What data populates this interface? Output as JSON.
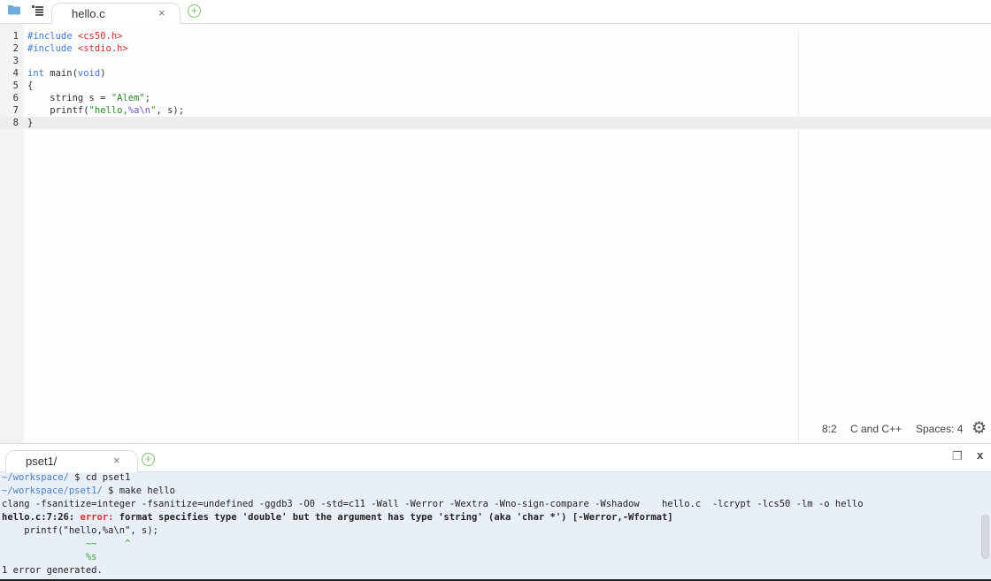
{
  "editor_tabs": [
    {
      "label": "hello.c",
      "close": "×"
    }
  ],
  "terminal_tabs": [
    {
      "label": "pset1/",
      "close": "×"
    }
  ],
  "icons": {
    "folder": "folder-icon",
    "outline": "outline-icon",
    "add": "+",
    "gear": "⚙",
    "restore": "❐",
    "close": "x"
  },
  "code_lines": [
    [
      {
        "t": "#include ",
        "c": "kw"
      },
      {
        "t": "<cs50.h>",
        "c": "inc"
      }
    ],
    [
      {
        "t": "#include ",
        "c": "kw"
      },
      {
        "t": "<stdio.h>",
        "c": "inc"
      }
    ],
    [],
    [
      {
        "t": "int",
        "c": "kw"
      },
      {
        "t": " main("
      },
      {
        "t": "void",
        "c": "kw"
      },
      {
        "t": ")"
      }
    ],
    [
      {
        "t": "{"
      }
    ],
    [
      {
        "t": "    string s = "
      },
      {
        "t": "\"Alem\"",
        "c": "str"
      },
      {
        "t": ";"
      }
    ],
    [
      {
        "t": "    printf("
      },
      {
        "t": "\"hello,",
        "c": "str"
      },
      {
        "t": "%a\\n",
        "c": "esc"
      },
      {
        "t": "\"",
        "c": "str"
      },
      {
        "t": ", s);"
      }
    ],
    [
      {
        "t": "}"
      }
    ]
  ],
  "active_line": 8,
  "status": {
    "cursor": "8:2",
    "language": "C and C++",
    "indent": "Spaces: 4"
  },
  "terminal_lines": [
    [
      {
        "t": "~/workspace/",
        "c": "path"
      },
      {
        "t": " $ cd pset1"
      }
    ],
    [
      {
        "t": "~/workspace/pset1/",
        "c": "path"
      },
      {
        "t": " $ make hello"
      }
    ],
    [
      {
        "t": "clang -fsanitize=integer -fsanitize=undefined -ggdb3 -O0 -std=c11 -Wall -Werror -Wextra -Wno-sign-compare -Wshadow    hello.c  -lcrypt -lcs50 -lm -o hello"
      }
    ],
    [
      {
        "t": "hello.c:7:26: ",
        "c": "b"
      },
      {
        "t": "error: ",
        "c": "err b"
      },
      {
        "t": "format specifies type 'double' but the argument has type 'string' (aka 'char *') [-Werror,-Wformat]",
        "c": "b"
      }
    ],
    [
      {
        "t": "    printf(\"hello,%a\\n\", s);"
      }
    ],
    [
      {
        "t": "               ~~     ^",
        "c": "grn"
      }
    ],
    [
      {
        "t": "               %s",
        "c": "grn"
      }
    ],
    [
      {
        "t": "1 error generated."
      }
    ]
  ]
}
